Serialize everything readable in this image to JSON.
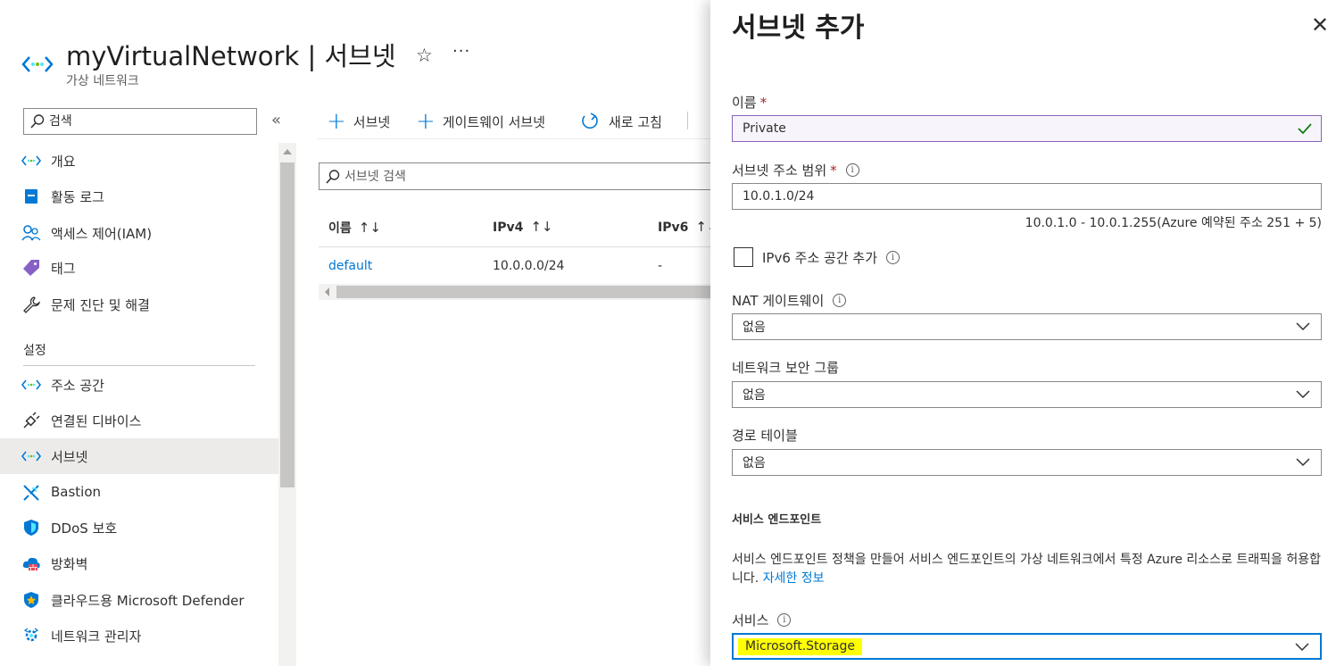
{
  "header": {
    "title": "myVirtualNetwork | 서브넷",
    "subtitle": "가상 네트워크"
  },
  "sidebar": {
    "search_placeholder": "검색",
    "items": [
      {
        "label": "개요",
        "icon": "network-icon"
      },
      {
        "label": "활동 로그",
        "icon": "activity-log-icon"
      },
      {
        "label": "액세스 제어(IAM)",
        "icon": "people-icon"
      },
      {
        "label": "태그",
        "icon": "tag-icon"
      },
      {
        "label": "문제 진단 및 해결",
        "icon": "wrench-icon"
      }
    ],
    "section_label": "설정",
    "settings_items": [
      {
        "label": "주소 공간",
        "icon": "network-icon"
      },
      {
        "label": "연결된 디바이스",
        "icon": "plug-icon"
      },
      {
        "label": "서브넷",
        "icon": "network-icon",
        "active": true
      },
      {
        "label": "Bastion",
        "icon": "bastion-icon"
      },
      {
        "label": "DDoS 보호",
        "icon": "shield-icon"
      },
      {
        "label": "방화벽",
        "icon": "firewall-icon"
      },
      {
        "label": "클라우드용 Microsoft Defender",
        "icon": "defender-icon"
      },
      {
        "label": "네트워크 관리자",
        "icon": "network-manager-icon"
      }
    ]
  },
  "toolbar": {
    "add_subnet": "서브넷",
    "add_gateway_subnet": "게이트웨이 서브넷",
    "refresh": "새로 고침"
  },
  "grid": {
    "search_placeholder": "서브넷 검색",
    "columns": [
      "이름",
      "IPv4",
      "IPv6"
    ],
    "sort_glyph": "↑↓",
    "rows": [
      {
        "name": "default",
        "ipv4": "10.0.0.0/24",
        "ipv6": "-"
      }
    ]
  },
  "panel": {
    "title": "서브넷 추가",
    "name_label": "이름",
    "required_mark": "*",
    "name_value": "Private",
    "range_label": "서브넷 주소 범위",
    "range_value": "10.0.1.0/24",
    "range_note": "10.0.1.0 - 10.0.1.255(Azure 예약된 주소 251 + 5)",
    "ipv6_checkbox": "IPv6 주소 공간 추가",
    "nat_label": "NAT 게이트웨이",
    "nat_value": "없음",
    "nsg_label": "네트워크 보안 그룹",
    "nsg_value": "없음",
    "route_label": "경로 테이블",
    "route_value": "없음",
    "endpoints_title": "서비스 엔드포인트",
    "endpoints_desc": "서비스 엔드포인트 정책을 만들어 서비스 엔드포인트의 가상 네트워크에서 특정 Azure 리소스로 트래픽을 허용합니다.",
    "learn_more": "자세한 정보",
    "services_label": "서비스",
    "services_value": "Microsoft.Storage"
  },
  "colors": {
    "accent": "#0078d4",
    "valid_border": "#8764b8",
    "valid_check": "#107c10",
    "highlight": "#ffff00",
    "required": "#a4262c"
  }
}
